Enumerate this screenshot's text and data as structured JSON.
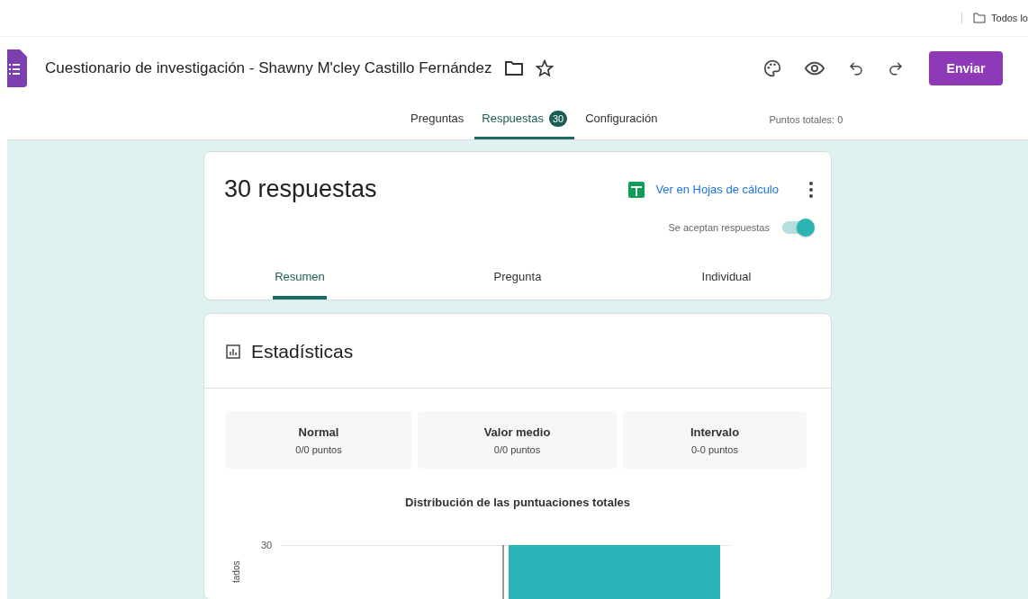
{
  "bookmarks": {
    "label": "Todos lo"
  },
  "header": {
    "title": "Cuestionario de investigación - Shawny M'cley Castillo Fernández",
    "send_button": "Enviar"
  },
  "tabs": [
    {
      "label": "Preguntas",
      "selected": false
    },
    {
      "label": "Respuestas",
      "selected": true,
      "badge": "30"
    },
    {
      "label": "Configuración",
      "selected": false
    }
  ],
  "total_points": "Puntos totales: 0",
  "responses_card": {
    "title": "30 respuestas",
    "sheets_link": "Ver en Hojas de cálculo",
    "accepting_label": "Se aceptan respuestas",
    "accepting_on": true,
    "tabs": [
      {
        "label": "Resumen",
        "selected": true
      },
      {
        "label": "Pregunta",
        "selected": false
      },
      {
        "label": "Individual",
        "selected": false
      }
    ]
  },
  "stats_card": {
    "title": "Estadísticas",
    "stats": [
      {
        "label": "Normal",
        "value": "0/0 puntos"
      },
      {
        "label": "Valor medio",
        "value": "0/0 puntos"
      },
      {
        "label": "Intervalo",
        "value": "0-0 puntos"
      }
    ],
    "chart_title": "Distribución de las puntuaciones totales",
    "ytick": "30",
    "ylabel": "tados"
  }
}
